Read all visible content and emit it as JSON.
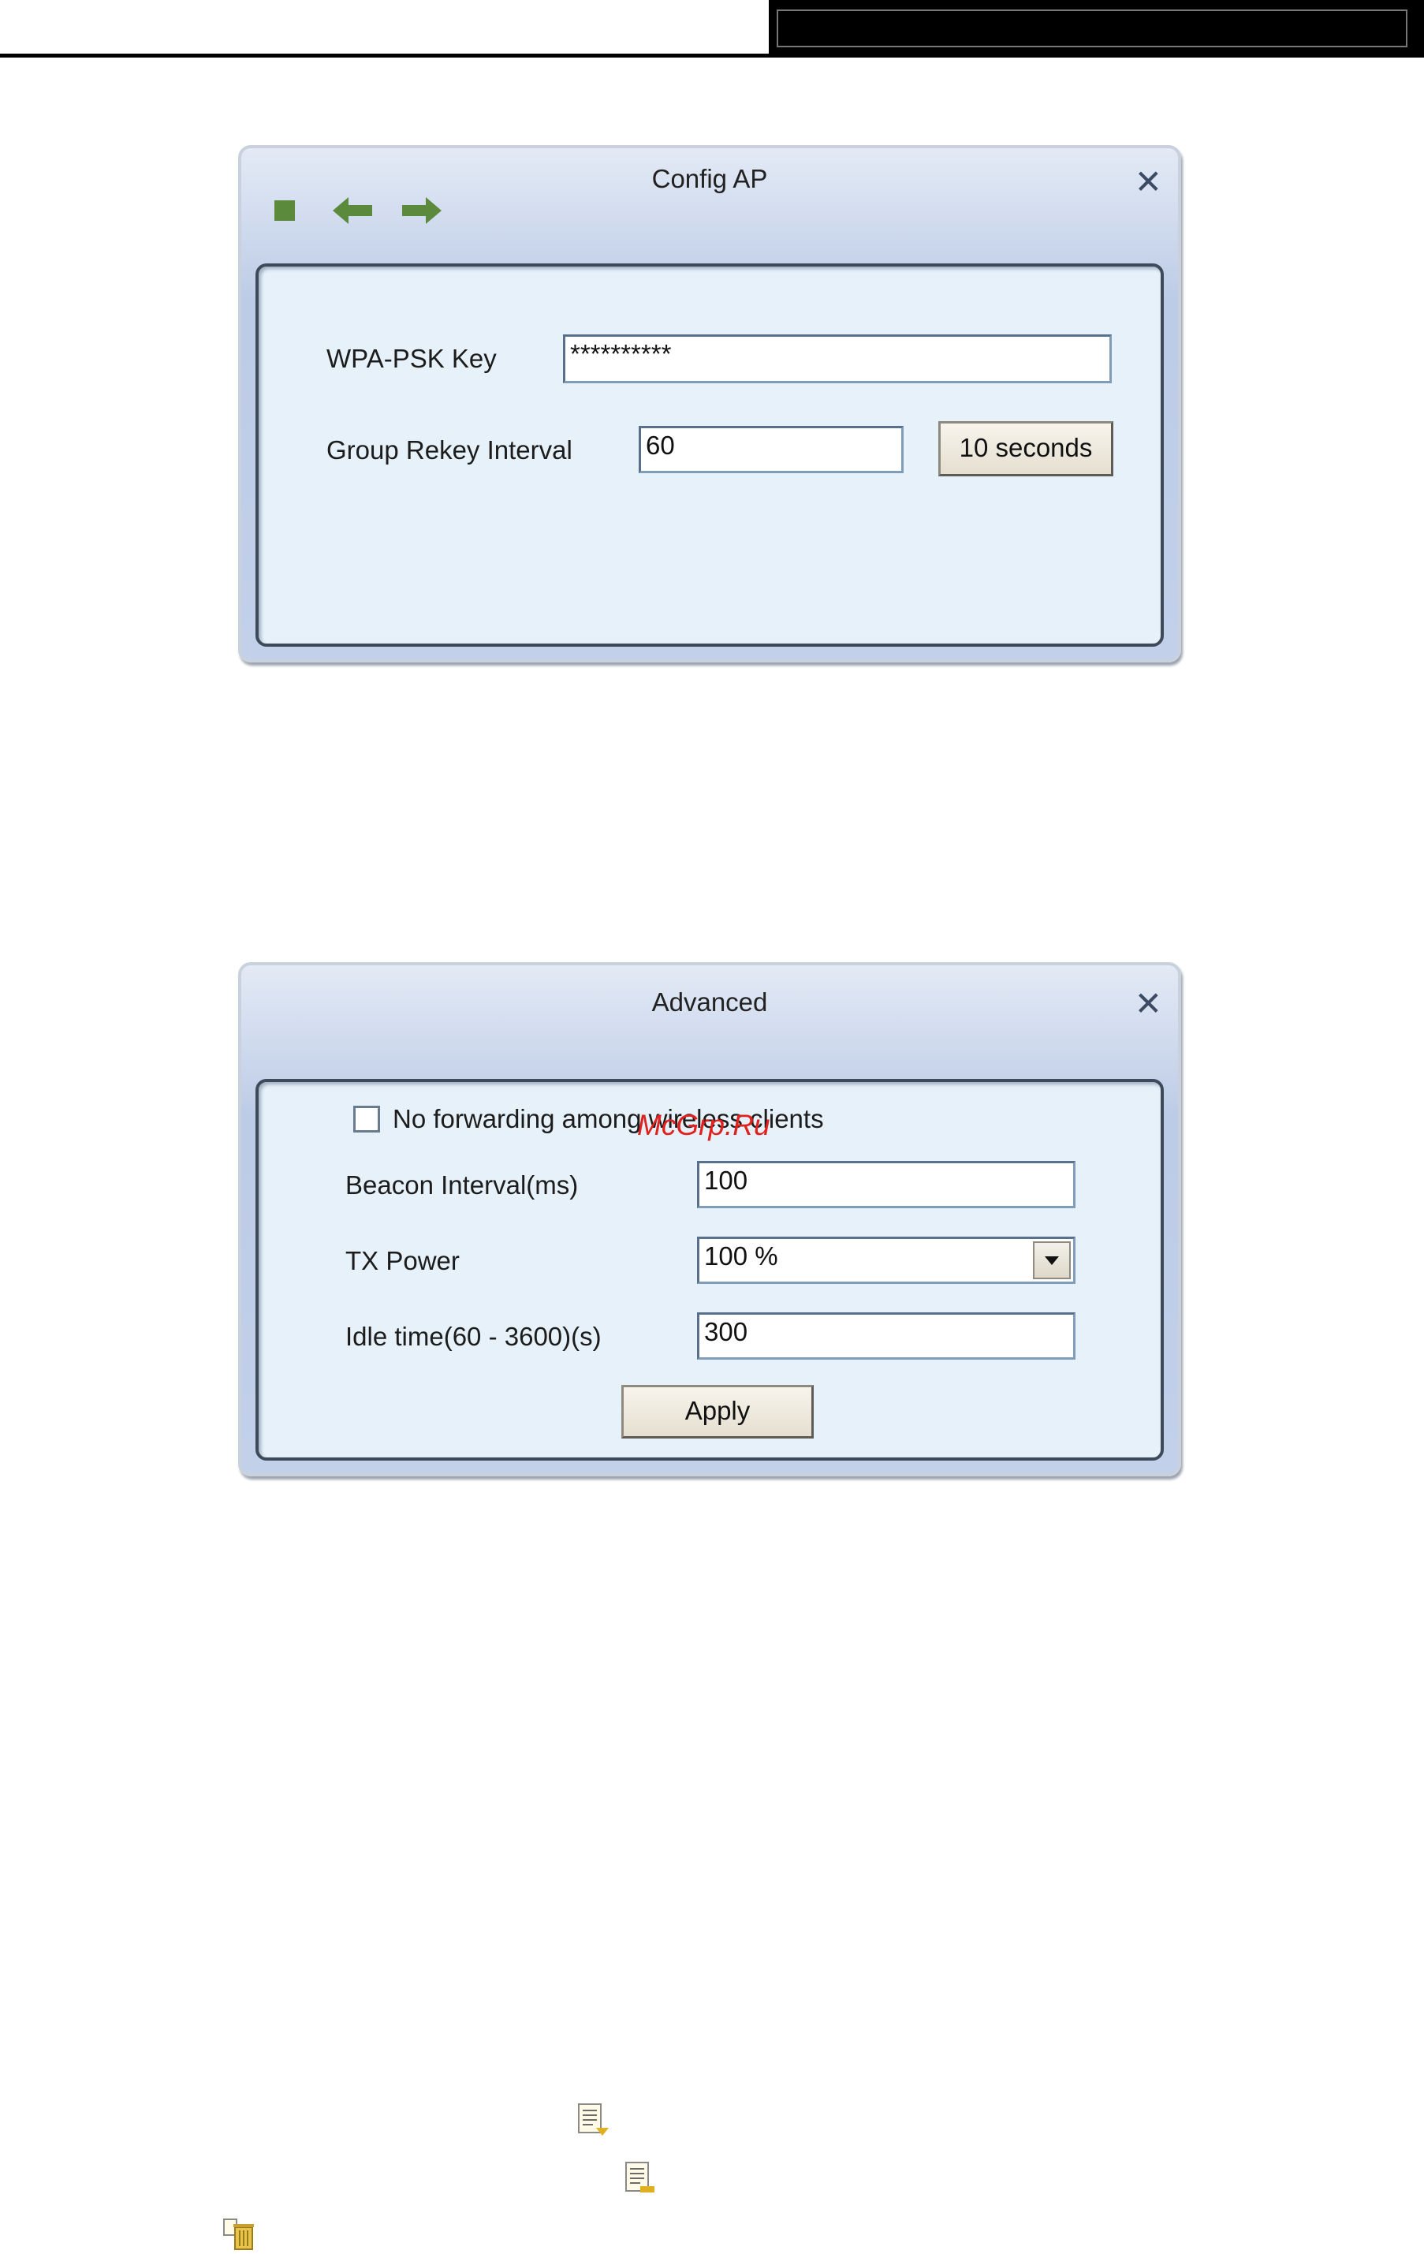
{
  "config_ap": {
    "title": "Config AP",
    "close": "✕",
    "wpa_psk_label": "WPA-PSK Key",
    "wpa_psk_value": "**********",
    "rekey_label": "Group Rekey Interval",
    "rekey_value": "60",
    "rekey_unit_button": "10 seconds"
  },
  "advanced": {
    "title": "Advanced",
    "close": "✕",
    "no_forwarding_label": "No forwarding among wireless clients",
    "no_forwarding_checked": false,
    "beacon_label": "Beacon Interval(ms)",
    "beacon_value": "100",
    "tx_power_label": "TX Power",
    "tx_power_value": "100 %",
    "idle_label": "Idle time(60 - 3600)(s)",
    "idle_value": "300",
    "apply_button": "Apply"
  },
  "watermark": "McGrp.Ru",
  "colors": {
    "toolbar_icon": "#5b8a3c",
    "watermark": "#e1211d"
  },
  "icons": [
    "stop-icon",
    "back-arrow-icon",
    "forward-arrow-icon",
    "close-icon",
    "dropdown-arrow-icon",
    "document-icon",
    "delete-icon"
  ]
}
